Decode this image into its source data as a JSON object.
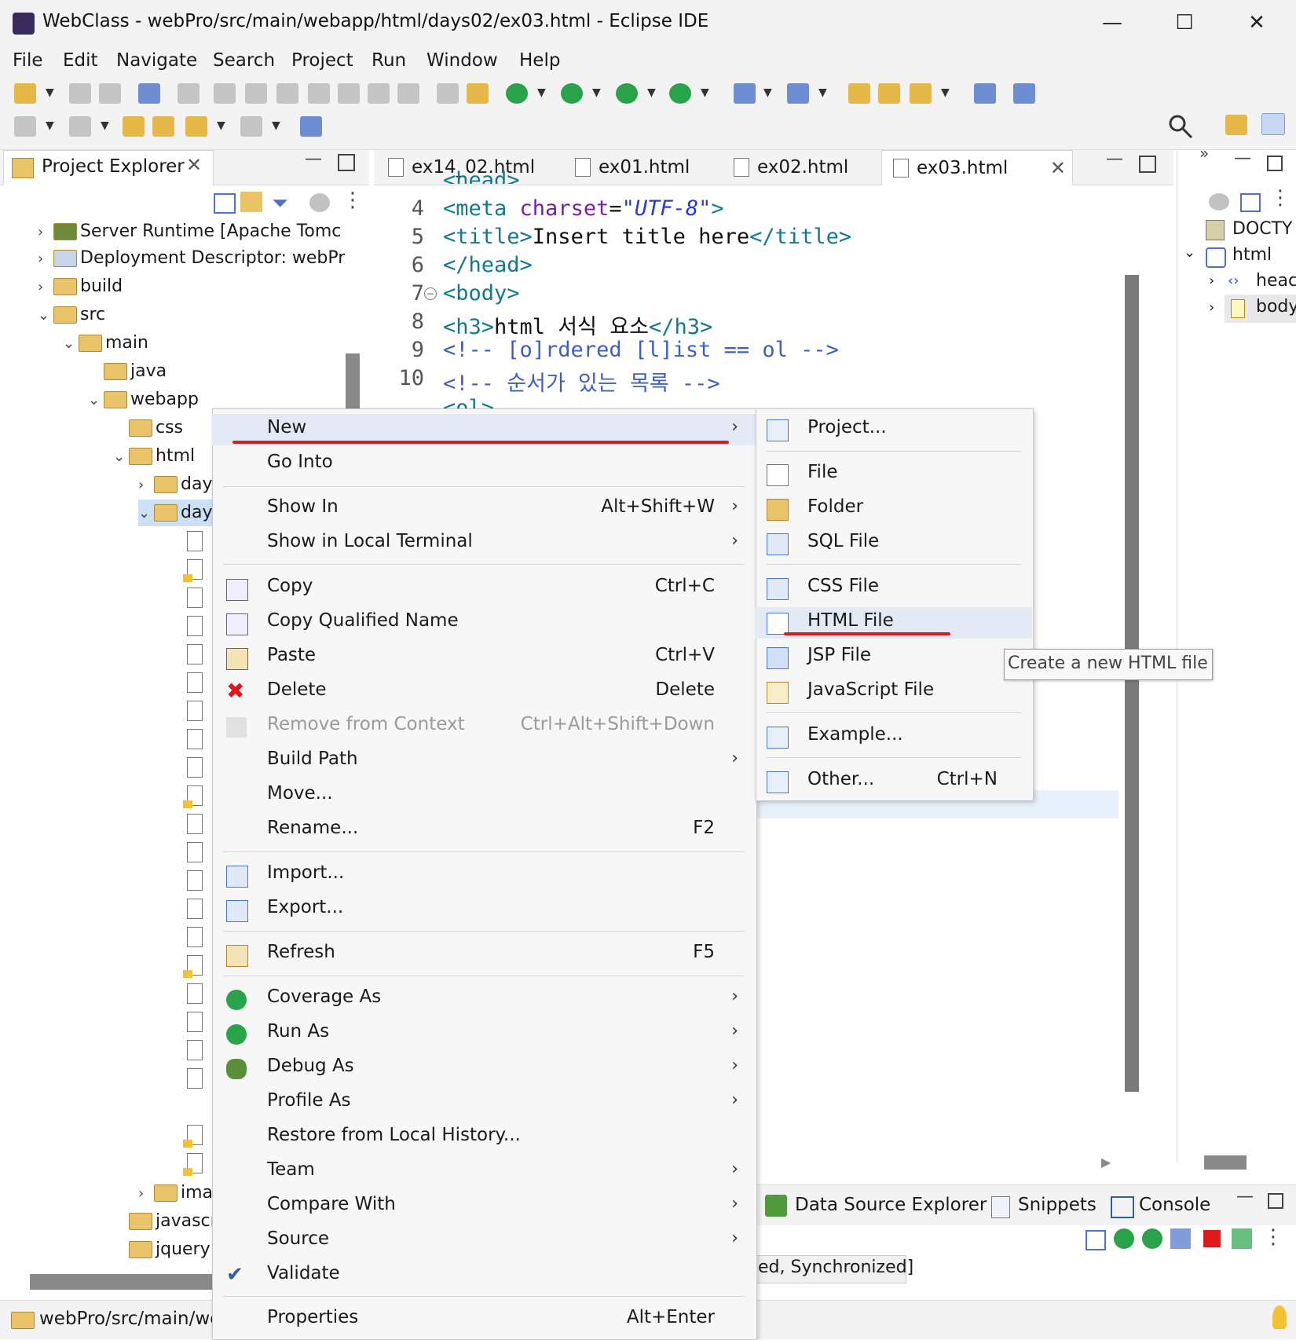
{
  "window": {
    "title": "WebClass - webPro/src/main/webapp/html/days02/ex03.html - Eclipse IDE",
    "min": "—",
    "max": "☐",
    "close": "✕"
  },
  "menubar": [
    "File",
    "Edit",
    "Navigate",
    "Search",
    "Project",
    "Run",
    "Window",
    "Help"
  ],
  "project_explorer": {
    "tab_label": "Project Explorer",
    "items": [
      {
        "label": "Server Runtime [Apache Tomc",
        "chevron": "›"
      },
      {
        "label": "Deployment Descriptor: webPr",
        "chevron": "›"
      },
      {
        "label": "build",
        "chevron": "›"
      },
      {
        "label": "src",
        "chevron": "⌄"
      },
      {
        "label": "main",
        "chevron": "⌄"
      },
      {
        "label": "java",
        "chevron": ""
      },
      {
        "label": "webapp",
        "chevron": "⌄"
      },
      {
        "label": "css",
        "chevron": ""
      },
      {
        "label": "html",
        "chevron": "⌄"
      },
      {
        "label": "day",
        "chevron": "›"
      },
      {
        "label": "day",
        "chevron": "⌄"
      },
      {
        "label": "ima",
        "chevron": "›"
      },
      {
        "label": "javascı",
        "chevron": ""
      },
      {
        "label": "jquery",
        "chevron": ""
      }
    ]
  },
  "status_path": "webPro/src/main/we",
  "editor": {
    "tabs": [
      "ex14_02.html",
      "ex01.html",
      "ex02.html",
      "ex03.html"
    ],
    "active_tab": "ex03.html",
    "line_numbers": [
      "4",
      "5",
      "6",
      "7",
      "8",
      "9",
      "10"
    ],
    "partial_top": "<head>",
    "partial_bottom": "<ol>",
    "lines": {
      "l4_tag": "<meta ",
      "l4_attr": "charset",
      "l4_eq": "=",
      "l4_val": "\"UTF-8\"",
      "l4_end": ">",
      "l5_open": "<title>",
      "l5_text": "Insert title here",
      "l5_close": "</title>",
      "l6": "</head>",
      "l7": "<body>",
      "l8_open": "<h3>",
      "l8_text": "html 서식 요소",
      "l8_close": "</h3>",
      "l9": "<!-- [o]rdered [l]ist == ol -->",
      "l10": "<!-- 순서가 있는 목록 -->"
    }
  },
  "outline": {
    "items": [
      "DOCTY",
      "html",
      "heac",
      "body"
    ]
  },
  "bottom_panel": {
    "tabs": [
      "Data Source Explorer",
      "Snippets",
      "Console"
    ],
    "status": "ed, Synchronized]"
  },
  "context_menu": {
    "items": [
      {
        "label": "New",
        "shortcut": "",
        "submenu": true
      },
      {
        "label": "Go Into",
        "shortcut": ""
      },
      {
        "label": "Show In",
        "shortcut": "Alt+Shift+W",
        "submenu": true
      },
      {
        "label": "Show in Local Terminal",
        "shortcut": "",
        "submenu": true
      },
      {
        "label": "Copy",
        "shortcut": "Ctrl+C"
      },
      {
        "label": "Copy Qualified Name",
        "shortcut": ""
      },
      {
        "label": "Paste",
        "shortcut": "Ctrl+V"
      },
      {
        "label": "Delete",
        "shortcut": "Delete"
      },
      {
        "label": "Remove from Context",
        "shortcut": "Ctrl+Alt+Shift+Down",
        "disabled": true
      },
      {
        "label": "Build Path",
        "shortcut": "",
        "submenu": true
      },
      {
        "label": "Move...",
        "shortcut": ""
      },
      {
        "label": "Rename...",
        "shortcut": "F2"
      },
      {
        "label": "Import...",
        "shortcut": ""
      },
      {
        "label": "Export...",
        "shortcut": ""
      },
      {
        "label": "Refresh",
        "shortcut": "F5"
      },
      {
        "label": "Coverage As",
        "shortcut": "",
        "submenu": true
      },
      {
        "label": "Run As",
        "shortcut": "",
        "submenu": true
      },
      {
        "label": "Debug As",
        "shortcut": "",
        "submenu": true
      },
      {
        "label": "Profile As",
        "shortcut": "",
        "submenu": true
      },
      {
        "label": "Restore from Local History...",
        "shortcut": ""
      },
      {
        "label": "Team",
        "shortcut": "",
        "submenu": true
      },
      {
        "label": "Compare With",
        "shortcut": "",
        "submenu": true
      },
      {
        "label": "Source",
        "shortcut": "",
        "submenu": true
      },
      {
        "label": "Validate",
        "shortcut": ""
      },
      {
        "label": "Properties",
        "shortcut": "Alt+Enter"
      }
    ]
  },
  "new_submenu": {
    "items": [
      {
        "label": "Project...",
        "shortcut": ""
      },
      {
        "label": "File",
        "shortcut": ""
      },
      {
        "label": "Folder",
        "shortcut": ""
      },
      {
        "label": "SQL File",
        "shortcut": ""
      },
      {
        "label": "CSS File",
        "shortcut": ""
      },
      {
        "label": "HTML File",
        "shortcut": ""
      },
      {
        "label": "JSP File",
        "shortcut": ""
      },
      {
        "label": "JavaScript File",
        "shortcut": ""
      },
      {
        "label": "Example...",
        "shortcut": ""
      },
      {
        "label": "Other...",
        "shortcut": "Ctrl+N"
      }
    ]
  },
  "tooltip": "Create a new HTML file",
  "colors": {
    "highlight_underline": "#e01818",
    "tag": "#147a8a",
    "attr": "#7a1fa2",
    "comment": "#3f5fbf"
  }
}
